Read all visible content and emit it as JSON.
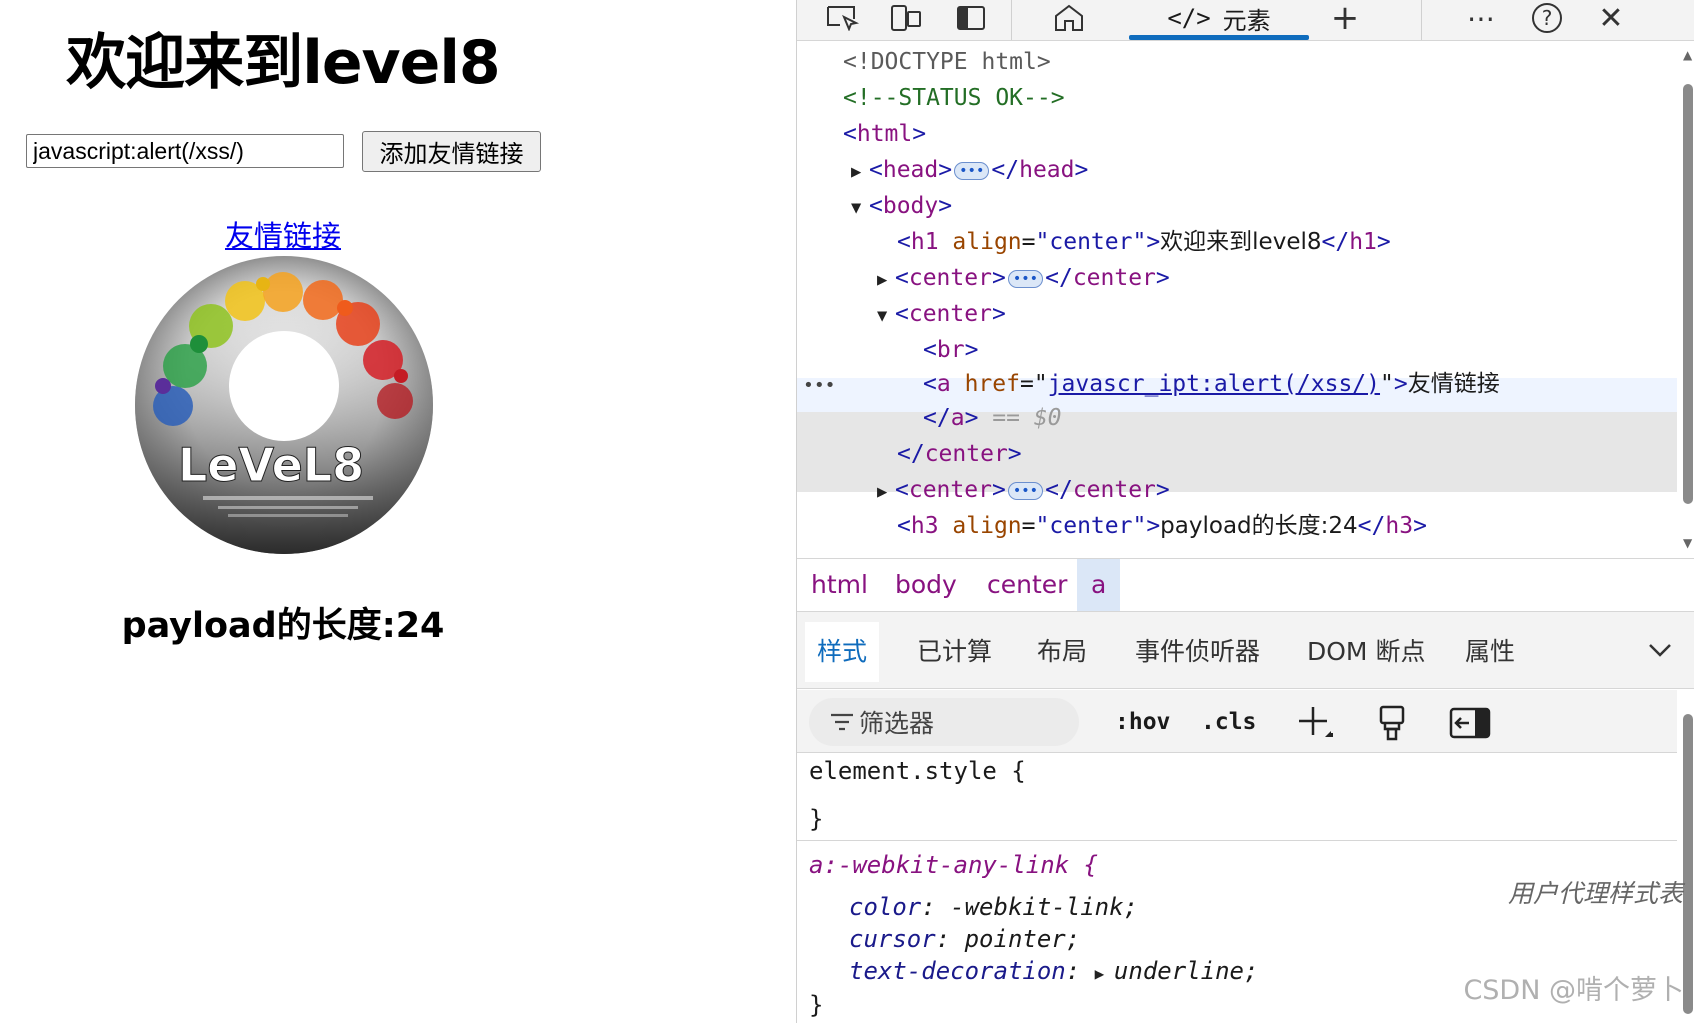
{
  "page": {
    "title": "欢迎来到level8",
    "input_value": "javascript:alert(/xss/)",
    "add_button": "添加友情链接",
    "link_text": "友情链接",
    "disc_logo": "LeVeL8",
    "payload_length": "payload的长度:24"
  },
  "devtools": {
    "tab_elements": "元素",
    "tab_elements_icon": "</>",
    "dom": {
      "doctype": "<!DOCTYPE html>",
      "comment": "<!--STATUS OK-->",
      "html_tag": "html",
      "head_tag": "head",
      "body_tag": "body",
      "h1_attr": "align",
      "h1_val": "\"center\"",
      "h1_text": "欢迎来到level8",
      "h1_tag": "h1",
      "center_tag": "center",
      "br_tag": "br",
      "a_tag": "a",
      "a_attr": "href",
      "a_href": "javascr_ipt:alert(/xss/)",
      "a_text": "友情链接",
      "a_equals": "== $0",
      "h3_tag": "h3",
      "h3_text": "payload的长度:24"
    },
    "breadcrumb": [
      "html",
      "body",
      "center",
      "a"
    ],
    "sub_tabs": [
      "样式",
      "已计算",
      "布局",
      "事件侦听器",
      "DOM 断点",
      "属性"
    ],
    "filter_placeholder": "筛选器",
    "hov": ":hov",
    "cls": ".cls",
    "styles": {
      "element_style": "element.style {",
      "close_brace": "}",
      "rule_selector": "a:-webkit-any-link {",
      "ua_label": "用户代理样式表",
      "props": [
        {
          "name": "color",
          "value": "-webkit-link;"
        },
        {
          "name": "cursor",
          "value": "pointer;"
        },
        {
          "name": "text-decoration",
          "value": "underline;"
        }
      ]
    }
  },
  "watermark": "CSDN @啃个萝卜"
}
